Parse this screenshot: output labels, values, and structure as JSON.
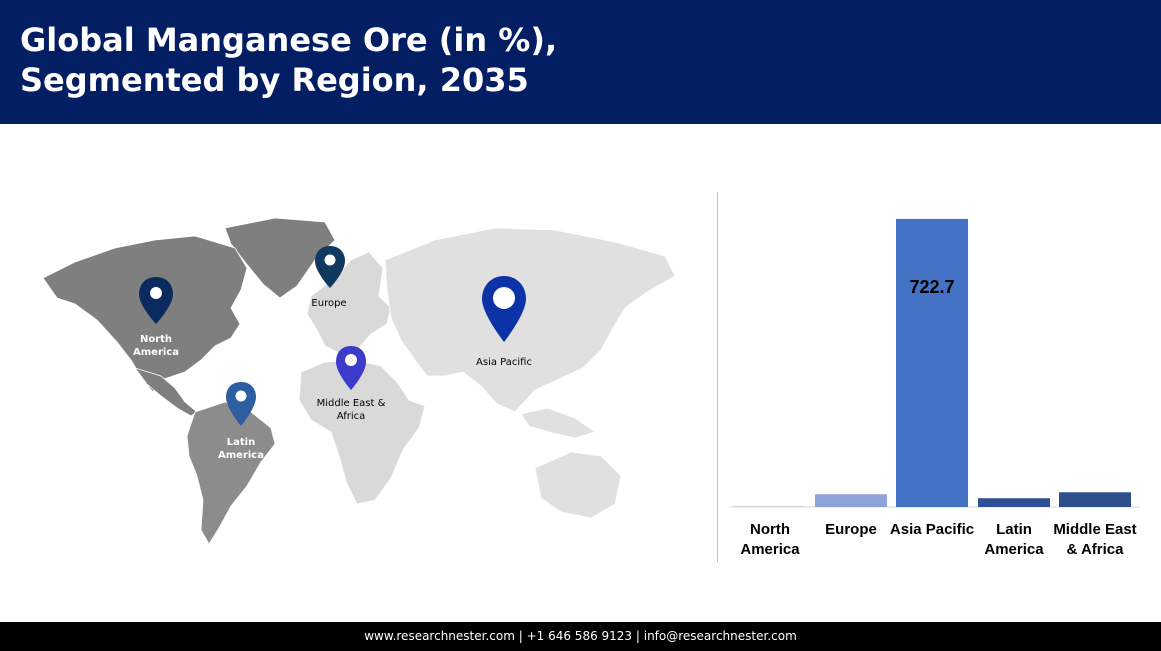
{
  "header": {
    "title_line1": "Global Manganese Ore (in %),",
    "title_line2": "Segmented by Region, 2035",
    "background_color": "#041e63"
  },
  "map": {
    "pins": [
      {
        "label_lines": [
          "North",
          "America"
        ],
        "color": "#0b2b5e"
      },
      {
        "label_lines": [
          "Europe"
        ],
        "color": "#113960"
      },
      {
        "label_lines": [
          "Asia Pacific"
        ],
        "color": "#0b32a6"
      },
      {
        "label_lines": [
          "Middle East &",
          "Africa"
        ],
        "color": "#3b3acb"
      },
      {
        "label_lines": [
          "Latin",
          "America"
        ],
        "color": "#2e5ea2"
      }
    ]
  },
  "chart_data": {
    "type": "bar",
    "categories": [
      "North America",
      "Europe",
      "Asia Pacific",
      "Latin America",
      "Middle East & Africa"
    ],
    "category_label_lines": [
      [
        "North",
        "America"
      ],
      [
        "Europe"
      ],
      [
        "Asia Pacific"
      ],
      [
        "Latin",
        "America"
      ],
      [
        "Middle East",
        "& Africa"
      ]
    ],
    "values": [
      3,
      32,
      722.7,
      22,
      37
    ],
    "data_labels": [
      "",
      "",
      "722.7",
      "",
      ""
    ],
    "colors": [
      "#d9d9d9",
      "#8ea3d8",
      "#4472c4",
      "#2f4f96",
      "#2d4f8c"
    ],
    "ylim": [
      0,
      730
    ],
    "grid": false,
    "legend": "none"
  },
  "footer": {
    "text": "www.researchnester.com  | +1 646 586 9123 | info@researchnester.com"
  }
}
